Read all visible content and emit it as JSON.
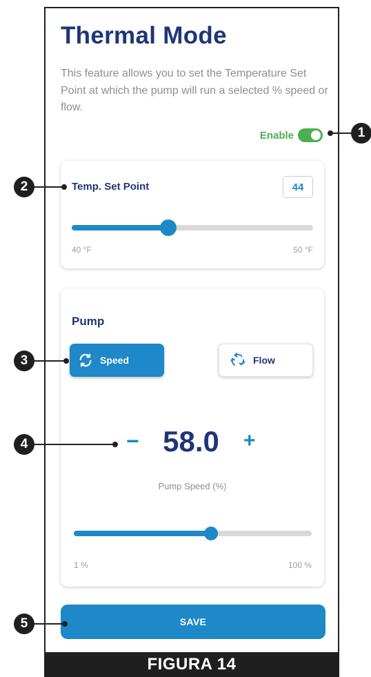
{
  "screen": {
    "title": "Thermal Mode",
    "description": "This feature allows you to set the Temperature Set Point at which the pump will run a selected % speed or flow.",
    "enable_label": "Enable",
    "enable_on": true
  },
  "setpoint": {
    "label": "Temp. Set Point",
    "value": "44",
    "min_label": "40 °F",
    "max_label": "50 °F",
    "min": 40,
    "max": 50,
    "current": 44
  },
  "pump": {
    "title": "Pump",
    "speed_button": "Speed",
    "flow_button": "Flow",
    "selected_mode": "Speed",
    "minus": "−",
    "plus": "+",
    "value": "58.0",
    "caption": "Pump Speed (%)",
    "min_label": "1 %",
    "max_label": "100 %",
    "min": 1,
    "max": 100,
    "current": 58
  },
  "save_label": "SAVE",
  "figure_label": "FIGURA 14",
  "callouts": [
    "1",
    "2",
    "3",
    "4",
    "5"
  ],
  "colors": {
    "accent": "#1e88c8",
    "title": "#1f3577",
    "enable": "#4caf50"
  }
}
